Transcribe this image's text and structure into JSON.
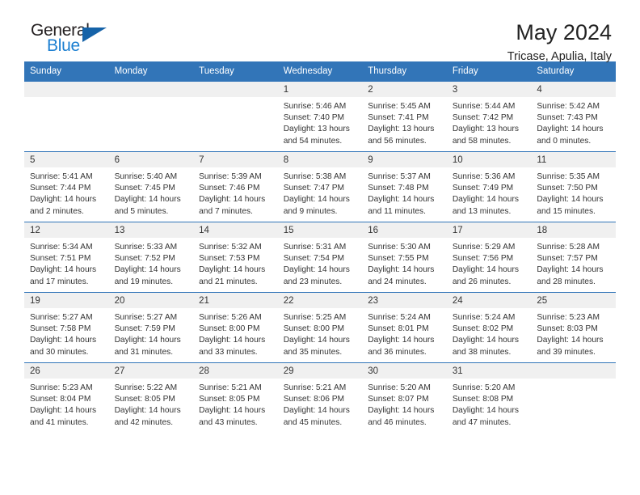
{
  "brand": {
    "name_part1": "General",
    "name_part2": "Blue",
    "logo_icon": "triangle-flag-icon"
  },
  "header": {
    "title": "May 2024",
    "subtitle": "Tricase, Apulia, Italy"
  },
  "colors": {
    "header_blue": "#3275b8",
    "brand_blue": "#1c7fd1",
    "logo_blue": "#1663a8",
    "daynum_band": "#f0f0f0",
    "text": "#333333"
  },
  "weekday_headers": [
    "Sunday",
    "Monday",
    "Tuesday",
    "Wednesday",
    "Thursday",
    "Friday",
    "Saturday"
  ],
  "labels": {
    "sunrise": "Sunrise:",
    "sunset": "Sunset:",
    "daylight": "Daylight:"
  },
  "weeks": [
    [
      {
        "day": "",
        "empty": true
      },
      {
        "day": "",
        "empty": true
      },
      {
        "day": "",
        "empty": true
      },
      {
        "day": "1",
        "sunrise": "Sunrise: 5:46 AM",
        "sunset": "Sunset: 7:40 PM",
        "daylight_l1": "Daylight: 13 hours",
        "daylight_l2": "and 54 minutes."
      },
      {
        "day": "2",
        "sunrise": "Sunrise: 5:45 AM",
        "sunset": "Sunset: 7:41 PM",
        "daylight_l1": "Daylight: 13 hours",
        "daylight_l2": "and 56 minutes."
      },
      {
        "day": "3",
        "sunrise": "Sunrise: 5:44 AM",
        "sunset": "Sunset: 7:42 PM",
        "daylight_l1": "Daylight: 13 hours",
        "daylight_l2": "and 58 minutes."
      },
      {
        "day": "4",
        "sunrise": "Sunrise: 5:42 AM",
        "sunset": "Sunset: 7:43 PM",
        "daylight_l1": "Daylight: 14 hours",
        "daylight_l2": "and 0 minutes."
      }
    ],
    [
      {
        "day": "5",
        "sunrise": "Sunrise: 5:41 AM",
        "sunset": "Sunset: 7:44 PM",
        "daylight_l1": "Daylight: 14 hours",
        "daylight_l2": "and 2 minutes."
      },
      {
        "day": "6",
        "sunrise": "Sunrise: 5:40 AM",
        "sunset": "Sunset: 7:45 PM",
        "daylight_l1": "Daylight: 14 hours",
        "daylight_l2": "and 5 minutes."
      },
      {
        "day": "7",
        "sunrise": "Sunrise: 5:39 AM",
        "sunset": "Sunset: 7:46 PM",
        "daylight_l1": "Daylight: 14 hours",
        "daylight_l2": "and 7 minutes."
      },
      {
        "day": "8",
        "sunrise": "Sunrise: 5:38 AM",
        "sunset": "Sunset: 7:47 PM",
        "daylight_l1": "Daylight: 14 hours",
        "daylight_l2": "and 9 minutes."
      },
      {
        "day": "9",
        "sunrise": "Sunrise: 5:37 AM",
        "sunset": "Sunset: 7:48 PM",
        "daylight_l1": "Daylight: 14 hours",
        "daylight_l2": "and 11 minutes."
      },
      {
        "day": "10",
        "sunrise": "Sunrise: 5:36 AM",
        "sunset": "Sunset: 7:49 PM",
        "daylight_l1": "Daylight: 14 hours",
        "daylight_l2": "and 13 minutes."
      },
      {
        "day": "11",
        "sunrise": "Sunrise: 5:35 AM",
        "sunset": "Sunset: 7:50 PM",
        "daylight_l1": "Daylight: 14 hours",
        "daylight_l2": "and 15 minutes."
      }
    ],
    [
      {
        "day": "12",
        "sunrise": "Sunrise: 5:34 AM",
        "sunset": "Sunset: 7:51 PM",
        "daylight_l1": "Daylight: 14 hours",
        "daylight_l2": "and 17 minutes."
      },
      {
        "day": "13",
        "sunrise": "Sunrise: 5:33 AM",
        "sunset": "Sunset: 7:52 PM",
        "daylight_l1": "Daylight: 14 hours",
        "daylight_l2": "and 19 minutes."
      },
      {
        "day": "14",
        "sunrise": "Sunrise: 5:32 AM",
        "sunset": "Sunset: 7:53 PM",
        "daylight_l1": "Daylight: 14 hours",
        "daylight_l2": "and 21 minutes."
      },
      {
        "day": "15",
        "sunrise": "Sunrise: 5:31 AM",
        "sunset": "Sunset: 7:54 PM",
        "daylight_l1": "Daylight: 14 hours",
        "daylight_l2": "and 23 minutes."
      },
      {
        "day": "16",
        "sunrise": "Sunrise: 5:30 AM",
        "sunset": "Sunset: 7:55 PM",
        "daylight_l1": "Daylight: 14 hours",
        "daylight_l2": "and 24 minutes."
      },
      {
        "day": "17",
        "sunrise": "Sunrise: 5:29 AM",
        "sunset": "Sunset: 7:56 PM",
        "daylight_l1": "Daylight: 14 hours",
        "daylight_l2": "and 26 minutes."
      },
      {
        "day": "18",
        "sunrise": "Sunrise: 5:28 AM",
        "sunset": "Sunset: 7:57 PM",
        "daylight_l1": "Daylight: 14 hours",
        "daylight_l2": "and 28 minutes."
      }
    ],
    [
      {
        "day": "19",
        "sunrise": "Sunrise: 5:27 AM",
        "sunset": "Sunset: 7:58 PM",
        "daylight_l1": "Daylight: 14 hours",
        "daylight_l2": "and 30 minutes."
      },
      {
        "day": "20",
        "sunrise": "Sunrise: 5:27 AM",
        "sunset": "Sunset: 7:59 PM",
        "daylight_l1": "Daylight: 14 hours",
        "daylight_l2": "and 31 minutes."
      },
      {
        "day": "21",
        "sunrise": "Sunrise: 5:26 AM",
        "sunset": "Sunset: 8:00 PM",
        "daylight_l1": "Daylight: 14 hours",
        "daylight_l2": "and 33 minutes."
      },
      {
        "day": "22",
        "sunrise": "Sunrise: 5:25 AM",
        "sunset": "Sunset: 8:00 PM",
        "daylight_l1": "Daylight: 14 hours",
        "daylight_l2": "and 35 minutes."
      },
      {
        "day": "23",
        "sunrise": "Sunrise: 5:24 AM",
        "sunset": "Sunset: 8:01 PM",
        "daylight_l1": "Daylight: 14 hours",
        "daylight_l2": "and 36 minutes."
      },
      {
        "day": "24",
        "sunrise": "Sunrise: 5:24 AM",
        "sunset": "Sunset: 8:02 PM",
        "daylight_l1": "Daylight: 14 hours",
        "daylight_l2": "and 38 minutes."
      },
      {
        "day": "25",
        "sunrise": "Sunrise: 5:23 AM",
        "sunset": "Sunset: 8:03 PM",
        "daylight_l1": "Daylight: 14 hours",
        "daylight_l2": "and 39 minutes."
      }
    ],
    [
      {
        "day": "26",
        "sunrise": "Sunrise: 5:23 AM",
        "sunset": "Sunset: 8:04 PM",
        "daylight_l1": "Daylight: 14 hours",
        "daylight_l2": "and 41 minutes."
      },
      {
        "day": "27",
        "sunrise": "Sunrise: 5:22 AM",
        "sunset": "Sunset: 8:05 PM",
        "daylight_l1": "Daylight: 14 hours",
        "daylight_l2": "and 42 minutes."
      },
      {
        "day": "28",
        "sunrise": "Sunrise: 5:21 AM",
        "sunset": "Sunset: 8:05 PM",
        "daylight_l1": "Daylight: 14 hours",
        "daylight_l2": "and 43 minutes."
      },
      {
        "day": "29",
        "sunrise": "Sunrise: 5:21 AM",
        "sunset": "Sunset: 8:06 PM",
        "daylight_l1": "Daylight: 14 hours",
        "daylight_l2": "and 45 minutes."
      },
      {
        "day": "30",
        "sunrise": "Sunrise: 5:20 AM",
        "sunset": "Sunset: 8:07 PM",
        "daylight_l1": "Daylight: 14 hours",
        "daylight_l2": "and 46 minutes."
      },
      {
        "day": "31",
        "sunrise": "Sunrise: 5:20 AM",
        "sunset": "Sunset: 8:08 PM",
        "daylight_l1": "Daylight: 14 hours",
        "daylight_l2": "and 47 minutes."
      },
      {
        "day": "",
        "empty": true
      }
    ]
  ]
}
